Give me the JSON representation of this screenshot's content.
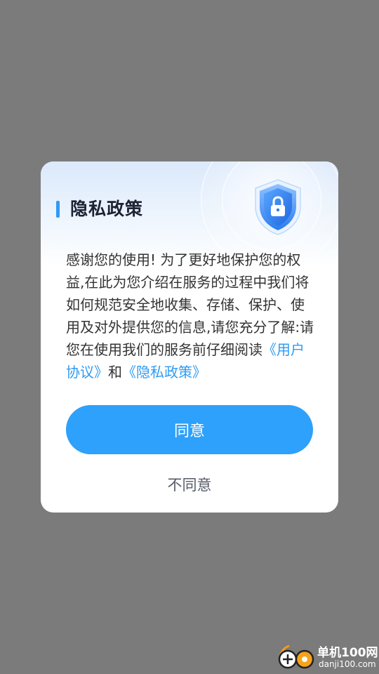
{
  "dialog": {
    "title": "隐私政策",
    "body_intro": "感谢您的使用! 为了更好地保护您的权益,在此为您介绍在服务的过程中我们将如何规范安全地收集、存储、保护、使用及对外提供您的信息,请您充分了解:请您在使用我们的服务前仔细阅读",
    "link_user_agreement": "《用户协议》",
    "conjunction": "和",
    "link_privacy_policy": "《隐私政策》",
    "agree_label": "同意",
    "disagree_label": "不同意",
    "shield_icon": "shield-lock-icon"
  },
  "watermark": {
    "name": "单机100网",
    "domain": "danji100.com"
  },
  "colors": {
    "overlay": "#7b7b7b",
    "accent": "#2da1fb",
    "title_bar": "#2f9bf3",
    "link": "#2f9bf3"
  }
}
